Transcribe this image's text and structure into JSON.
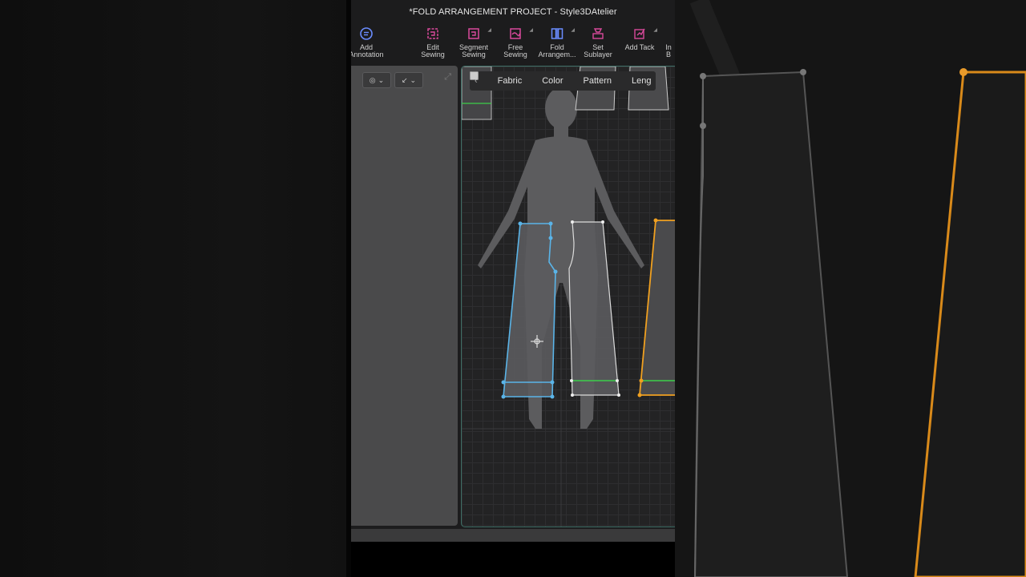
{
  "window": {
    "title": "*FOLD ARRANGEMENT PROJECT - Style3DAtelier"
  },
  "toolbar": {
    "items": [
      {
        "label": "Add\nAnnotation",
        "icon": "annotation-icon"
      },
      {
        "label": "Edit\nSewing",
        "icon": "edit-sewing-icon"
      },
      {
        "label": "Segment\nSewing",
        "icon": "segment-sewing-icon"
      },
      {
        "label": "Free\nSewing",
        "icon": "free-sewing-icon"
      },
      {
        "label": "Fold\nArrangem...",
        "icon": "fold-arrangement-icon"
      },
      {
        "label": "Set\nSublayer",
        "icon": "set-sublayer-icon"
      },
      {
        "label": "Add Tack",
        "icon": "add-tack-icon"
      },
      {
        "label": "In\nB",
        "icon": "partial-tool-icon"
      }
    ]
  },
  "viewport": {
    "tabs": [
      {
        "label": "Fabric",
        "icon": "fabric-icon"
      },
      {
        "label": "Color",
        "icon": "color-icon"
      },
      {
        "label": "Pattern",
        "icon": "pattern-icon"
      },
      {
        "label": "Leng",
        "icon": "length-icon"
      }
    ]
  },
  "colors": {
    "accent_pink": "#d9499b",
    "accent_blue": "#6a8cff",
    "selected_piece": "#5ab4e8",
    "highlight_piece": "#f0a020",
    "seam_green": "#3ccf4a",
    "viewport_border": "#3e6e66"
  }
}
